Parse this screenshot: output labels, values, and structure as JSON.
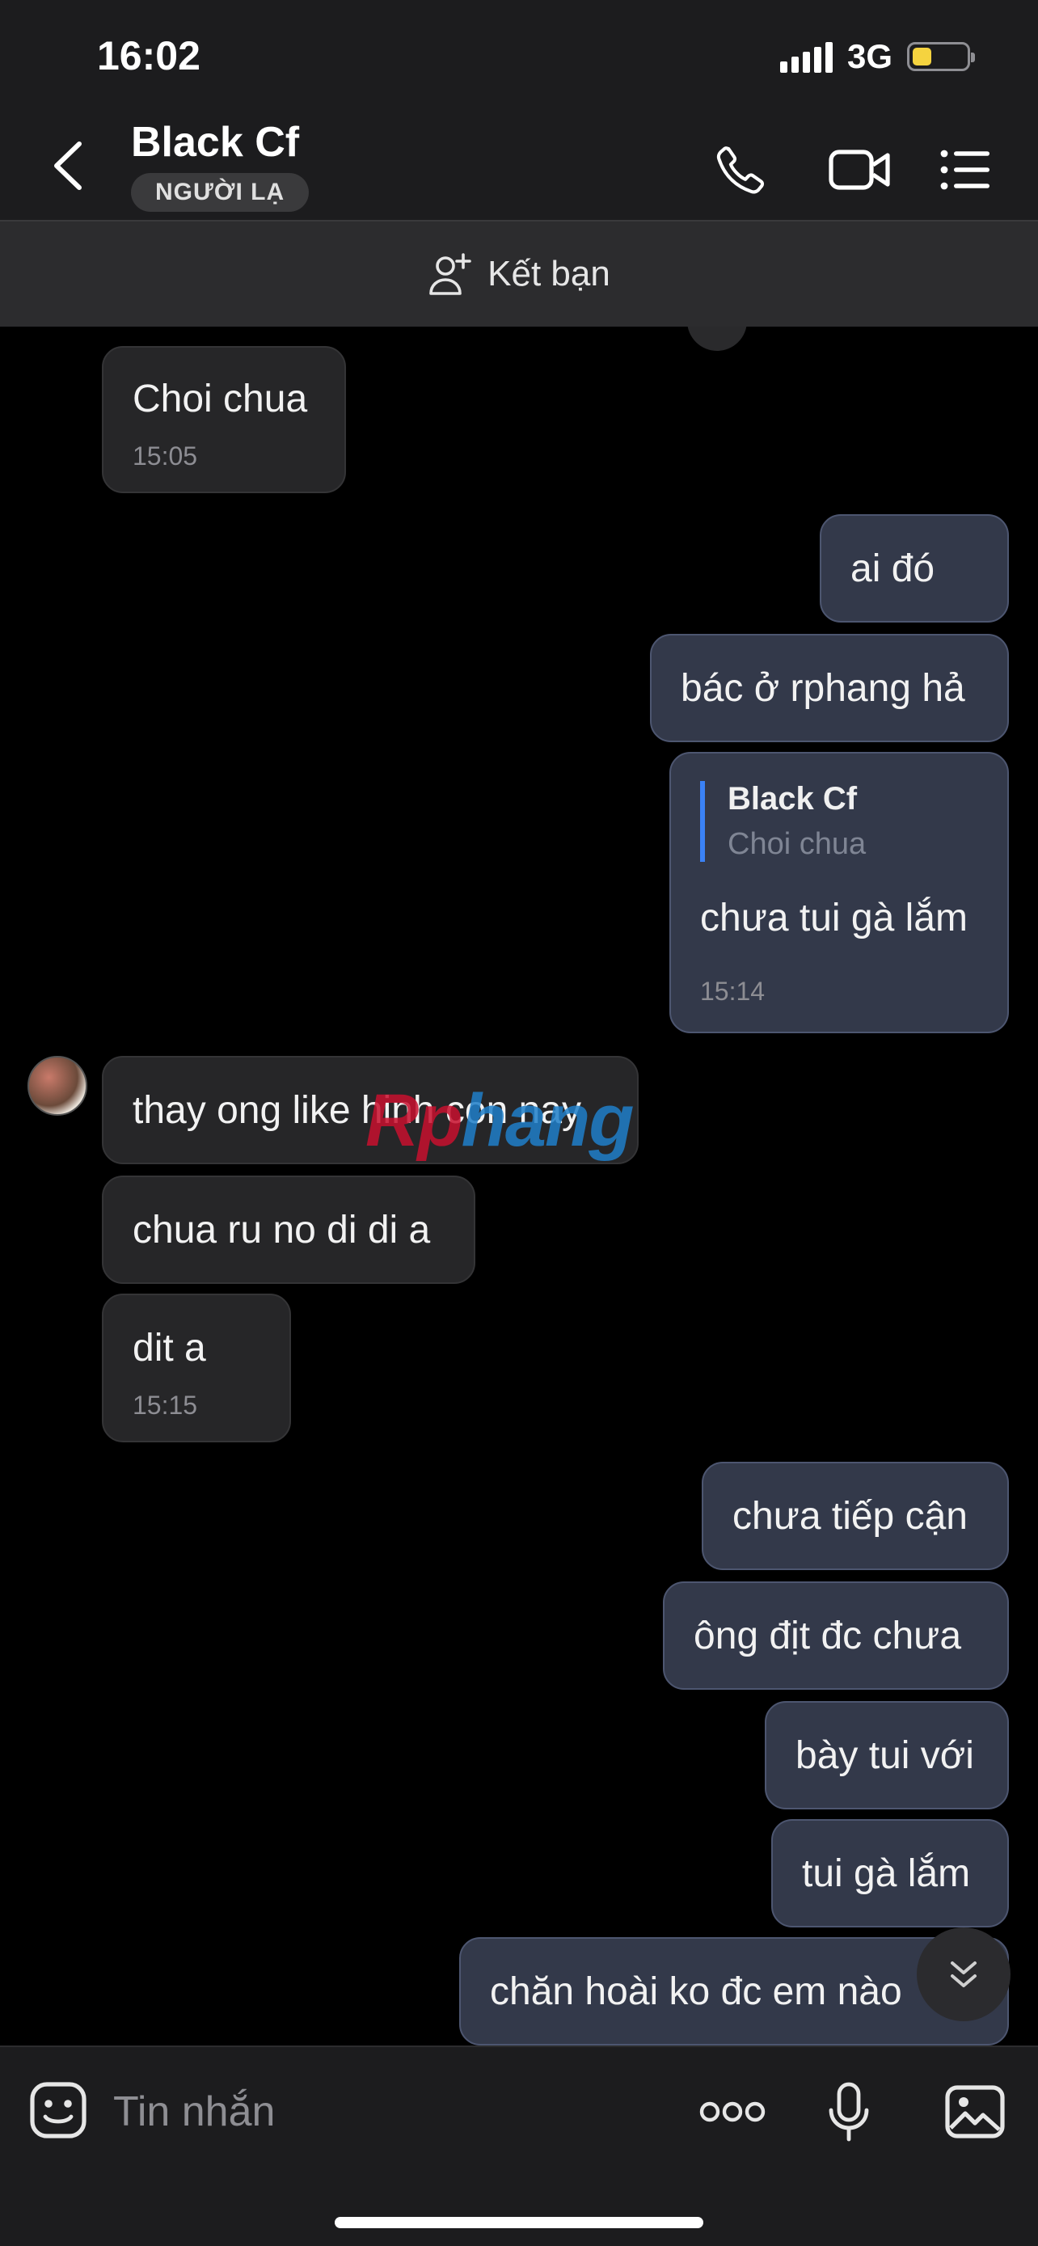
{
  "status": {
    "time": "16:02",
    "network": "3G",
    "battery_level": 0.35
  },
  "header": {
    "contact_name": "Black Cf",
    "badge": "NGƯỜI LẠ"
  },
  "friend_bar": {
    "label": "Kết bạn"
  },
  "messages": [
    {
      "side": "in",
      "text": "Choi chua",
      "time": "15:05"
    },
    {
      "side": "out",
      "text": "ai đó"
    },
    {
      "side": "out",
      "text": "bác ở rphang hả"
    },
    {
      "side": "out",
      "quote_name": "Black Cf",
      "quote_text": "Choi chua",
      "text": "chưa tui gà lắm",
      "time": "15:14"
    },
    {
      "side": "in",
      "text": "thay ong like hinh con nay"
    },
    {
      "side": "in",
      "text": "chua ru no di di a"
    },
    {
      "side": "in",
      "text": "dit a",
      "time": "15:15"
    },
    {
      "side": "out",
      "text": "chưa tiếp cận"
    },
    {
      "side": "out",
      "text": "ông địt đc chưa"
    },
    {
      "side": "out",
      "text": "bày tui với"
    },
    {
      "side": "out",
      "text": "tui gà lắm"
    },
    {
      "side": "out",
      "text": "chăn hoài ko đc em nào"
    }
  ],
  "watermark": {
    "part1": "Rp",
    "part2": "hang"
  },
  "composer": {
    "placeholder": "Tin nhắn"
  },
  "icons": {
    "back": "chevron-left-icon",
    "call": "phone-icon",
    "video": "video-camera-icon",
    "menu": "list-menu-icon",
    "add_friend": "add-user-icon",
    "emoji": "sticker-icon",
    "more": "more-dots-icon",
    "mic": "microphone-icon",
    "image": "image-icon",
    "scroll": "double-chevron-down-icon"
  },
  "colors": {
    "accent": "#3b82f6",
    "outgoing_bubble": "#33394a",
    "incoming_bubble": "#262628",
    "battery": "#f5d33f"
  }
}
